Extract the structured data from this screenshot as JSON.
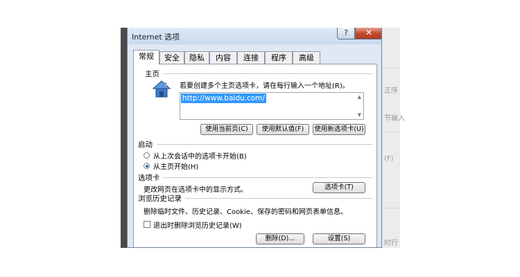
{
  "window": {
    "title": "Internet 选项",
    "help_label": "?",
    "close_label": "✕"
  },
  "tabs": [
    "常规",
    "安全",
    "隐私",
    "内容",
    "连接",
    "程序",
    "高级"
  ],
  "home": {
    "section_label": "主页",
    "instruction": "若要创建多个主页选项卡，请在每行输入一个地址(R)。",
    "url_value": "http://www.baidu.com/",
    "btn_current": "使用当前页(C)",
    "btn_default": "使用默认值(F)",
    "btn_newtab": "使用新选项卡(U)"
  },
  "startup": {
    "section_label": "启动",
    "option_last_session": "从上次会话中的选项卡开始(B)",
    "option_home": "从主页开始(H)",
    "selected": "option_home"
  },
  "tabs_section": {
    "section_label": "选项卡",
    "description": "更改网页在选项卡中的显示方式。",
    "btn_tabs": "选项卡(T)"
  },
  "history": {
    "section_label": "浏览历史记录",
    "description": "删除临时文件、历史记录、Cookie、保存的密码和网页表单信息。",
    "checkbox_label": "退出时删除浏览历史记录(W)",
    "btn_delete": "删除(D)...",
    "btn_settings": "设置(S)"
  },
  "background_fragments": [
    "正序",
    "节输入",
    "(F)",
    "时行"
  ]
}
